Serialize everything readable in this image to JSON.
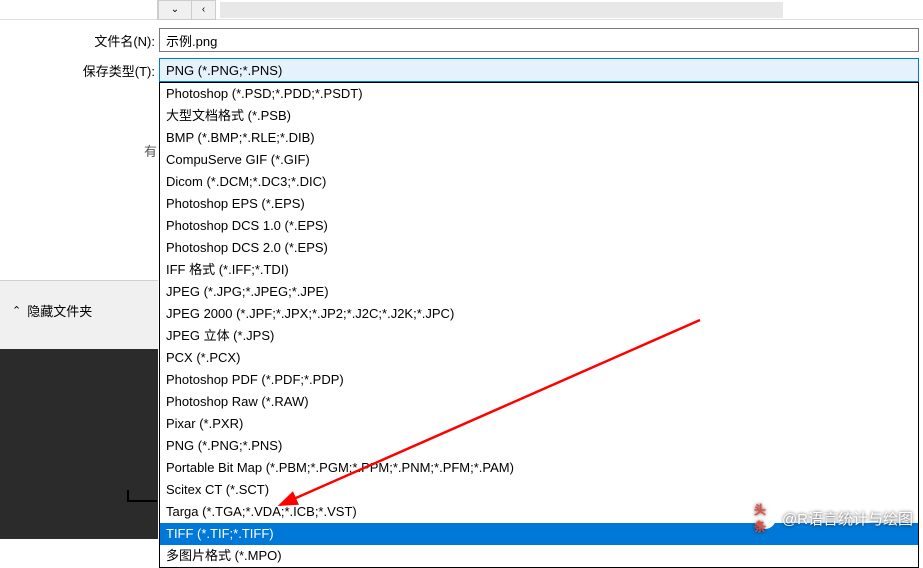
{
  "topbar": {
    "dropdown_icon": "⌄",
    "back_icon": "‹"
  },
  "fields": {
    "filename_label": "文件名(N):",
    "filename_value": "示例.png",
    "savetype_label": "保存类型(T):",
    "savetype_value": "PNG (*.PNG;*.PNS)"
  },
  "truncated_char": "有",
  "dropdown": {
    "items": [
      "Photoshop (*.PSD;*.PDD;*.PSDT)",
      "大型文档格式 (*.PSB)",
      "BMP (*.BMP;*.RLE;*.DIB)",
      "CompuServe GIF (*.GIF)",
      "Dicom (*.DCM;*.DC3;*.DIC)",
      "Photoshop EPS (*.EPS)",
      "Photoshop DCS 1.0 (*.EPS)",
      "Photoshop DCS 2.0 (*.EPS)",
      "IFF 格式 (*.IFF;*.TDI)",
      "JPEG (*.JPG;*.JPEG;*.JPE)",
      "JPEG 2000 (*.JPF;*.JPX;*.JP2;*.J2C;*.J2K;*.JPC)",
      "JPEG 立体 (*.JPS)",
      "PCX (*.PCX)",
      "Photoshop PDF (*.PDF;*.PDP)",
      "Photoshop Raw (*.RAW)",
      "Pixar (*.PXR)",
      "PNG (*.PNG;*.PNS)",
      "Portable Bit Map (*.PBM;*.PGM;*.PPM;*.PNM;*.PFM;*.PAM)",
      "Scitex CT (*.SCT)",
      "Targa (*.TGA;*.VDA;*.ICB;*.VST)",
      "TIFF (*.TIF;*.TIFF)",
      "多图片格式 (*.MPO)"
    ],
    "selected_index": 20
  },
  "sidebar": {
    "hide_folders_label": "隐藏文件夹"
  },
  "watermark": {
    "logo_text": "头条",
    "text": "@R语言统计与绘图"
  },
  "annotation": {
    "arrow_color": "#ff0000"
  }
}
